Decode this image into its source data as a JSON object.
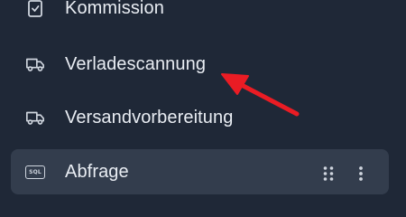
{
  "sidebar": {
    "items": [
      {
        "label": "Kommission",
        "icon": "clipboard-check-icon"
      },
      {
        "label": "Verladescannung",
        "icon": "truck-icon"
      },
      {
        "label": "Versandvorbereitung",
        "icon": "truck-icon"
      },
      {
        "label": "Abfrage",
        "icon": "sql-icon",
        "icon_text": "SQL",
        "active": true
      }
    ]
  },
  "colors": {
    "background": "#1f2837",
    "active_item_background": "#333d4d",
    "text": "#e9edf3",
    "icon": "#cfd5de",
    "annotation_arrow": "#ea1c24"
  }
}
